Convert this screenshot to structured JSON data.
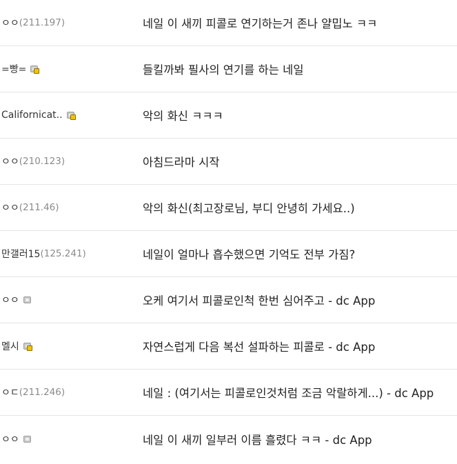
{
  "comments": [
    {
      "nick": "ㅇㅇ",
      "ip": "(211.197)",
      "badge": "none",
      "text": "네일 이 새끼 피콜로 연기하는거 존나 얄밉노 ㅋㅋ"
    },
    {
      "nick": "=빵=",
      "ip": "",
      "badge": "fixed",
      "text": "들킬까봐 필사의 연기를 하는 네일"
    },
    {
      "nick": "Californicat..",
      "ip": "",
      "badge": "fixed",
      "text": "악의 화신 ㅋㅋㅋ"
    },
    {
      "nick": "ㅇㅇ",
      "ip": "(210.123)",
      "badge": "none",
      "text": "아침드라마 시작"
    },
    {
      "nick": "ㅇㅇ",
      "ip": "(211.46)",
      "badge": "none",
      "text": "악의 화신(최고장로님, 부디 안녕히 가세요..)"
    },
    {
      "nick": "만갤러15",
      "ip": "(125.241)",
      "badge": "none",
      "text": "네일이 얼마나 흡수했으면 기억도 전부 가짐?"
    },
    {
      "nick": "ㅇㅇ",
      "ip": "",
      "badge": "semi",
      "text": "오케 여기서 피콜로인척 한번 심어주고 - dc App"
    },
    {
      "nick": "멜시",
      "ip": "",
      "badge": "fixed",
      "text": "자연스럽게 다음 복선 설파하는 피콜로 - dc App"
    },
    {
      "nick": "ㅇㄷ",
      "ip": "(211.246)",
      "badge": "none",
      "text": "네일 : (여기서는 피콜로인것처럼 조금 악랄하게...) - dc App"
    },
    {
      "nick": "ㅇㅇ",
      "ip": "",
      "badge": "semi",
      "text": "네일 이 새끼 일부러 이름 흘렸다 ㅋㅋ - dc App"
    }
  ],
  "icons": {
    "fixed": "gallog-fixed-nick-icon",
    "semi": "gallog-semi-nick-icon"
  },
  "colors": {
    "ip": "#8a8a8a",
    "divider": "#e4e4e4",
    "badge_gold": "#f2c400"
  }
}
